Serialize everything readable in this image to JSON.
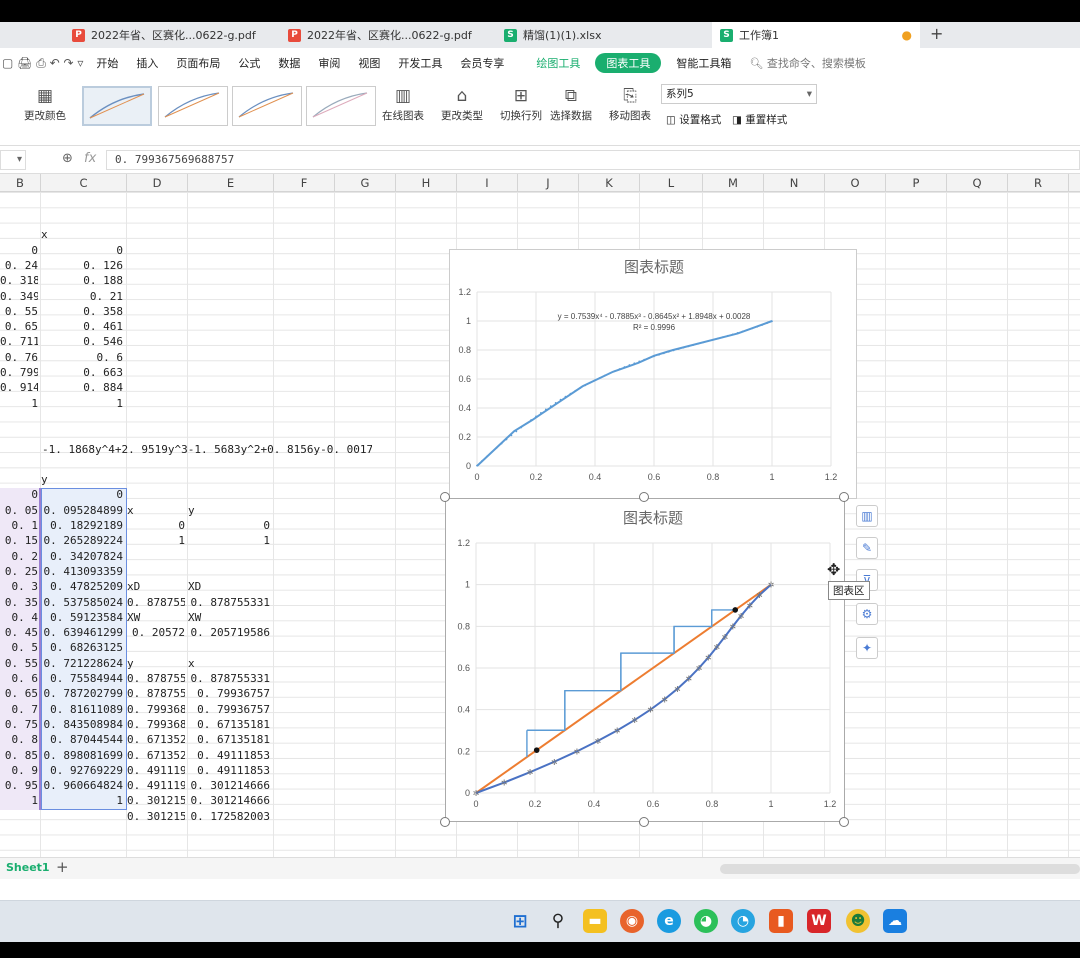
{
  "tabs": [
    {
      "label": "2022年省、区赛化...0622-g.pdf",
      "type": "pdf"
    },
    {
      "label": "2022年省、区赛化...0622-g.pdf",
      "type": "pdf"
    },
    {
      "label": "精馏(1)(1).xlsx",
      "type": "et"
    },
    {
      "label": "工作簿1",
      "type": "et"
    }
  ],
  "menu": {
    "items": [
      "开始",
      "插入",
      "页面布局",
      "公式",
      "数据",
      "审阅",
      "视图",
      "开发工具",
      "会员专享"
    ],
    "drawing_tools": "绘图工具",
    "chart_tools": "图表工具",
    "smart_tools": "智能工具箱",
    "search": "查找命令、搜索模板"
  },
  "ribbon": {
    "change_color": "更改颜色",
    "online_chart": "在线图表",
    "change_type": "更改类型",
    "switch_rowcol": "切换行列",
    "select_data": "选择数据",
    "move_chart": "移动图表",
    "series_select": "系列5",
    "set_format": "设置格式",
    "reset_style": "重置样式"
  },
  "formula_bar": {
    "fx": "fx",
    "value": "0. 799367569688757"
  },
  "columns": [
    "B",
    "C",
    "D",
    "E",
    "F",
    "G",
    "H",
    "I",
    "J",
    "K",
    "L",
    "M",
    "N",
    "O",
    "P",
    "Q",
    "R"
  ],
  "sheet": {
    "top_header": "x",
    "table1_b": [
      "0",
      "0. 24",
      "0. 318",
      "0. 349",
      "0. 55",
      "0. 65",
      "0. 711",
      "0. 76",
      "0. 799",
      "0. 914",
      "1"
    ],
    "table1_c": [
      "0",
      "0. 126",
      "0. 188",
      "0. 21",
      "0. 358",
      "0. 461",
      "0. 546",
      "0. 6",
      "0. 663",
      "0. 884",
      "1"
    ],
    "formula_text": "-1. 1868y^4+2. 9519y^3-1. 5683y^2+0. 8156y-0. 0017",
    "y_header": "y",
    "table2_b": [
      "0",
      "0. 05",
      "0. 1",
      "0. 15",
      "0. 2",
      "0. 25",
      "0. 3",
      "0. 35",
      "0. 4",
      "0. 45",
      "0. 5",
      "0. 55",
      "0. 6",
      "0. 65",
      "0. 7",
      "0. 75",
      "0. 8",
      "0. 85",
      "0. 9",
      "0. 95",
      "1"
    ],
    "table2_c": [
      "0",
      "0. 095284899",
      "0. 18292189",
      "0. 265289224",
      "0. 34207824",
      "0. 413093359",
      "0. 47825209",
      "0. 537585024",
      "0. 59123584",
      "0. 639461299",
      "0. 68263125",
      "0. 721228624",
      "0. 75584944",
      "0. 787202799",
      "0. 81611089",
      "0. 843508984",
      "0. 87044544",
      "0. 898081699",
      "0. 92769229",
      "0. 960664824",
      "1"
    ],
    "block_d_label_x": "x",
    "block_e_label_y": "y",
    "xy_d": [
      "0",
      "1"
    ],
    "xy_e": [
      "0",
      "1"
    ],
    "xd_d_label": "xD",
    "xd_e_label": "XD",
    "xd_d_value": "0. 878755",
    "xd_e_value": "0. 878755331",
    "xw_d_label": "XW",
    "xw_e_label": "XW",
    "xw_d_value": "0. 20572",
    "xw_e_value": "0. 205719586",
    "steps_header_d": "y",
    "steps_header_e": "x",
    "steps_d": [
      "0. 878755",
      "0. 878755",
      "0. 799368",
      "0. 799368",
      "0. 671352",
      "0. 671352",
      "0. 491119",
      "0. 491119",
      "0. 301215",
      "0. 301215"
    ],
    "steps_e": [
      "0. 878755331",
      "0. 79936757",
      "0. 79936757",
      "0. 67135181",
      "0. 67135181",
      "0. 49111853",
      "0. 49111853",
      "0. 301214666",
      "0. 301214666",
      "0. 172582003"
    ]
  },
  "tooltip": "图表区",
  "sheet_tab": "Sheet1",
  "colors": {
    "accent": "#1aae6f",
    "series_blue": "#5b9bd5",
    "series_orange": "#ed7d31",
    "step_blue": "#5b9bd5"
  },
  "chart_data": [
    {
      "type": "scatter",
      "title": "图表标题",
      "trendline_equation": "y = 0.7539x⁴ - 0.7885x³ - 0.8645x² + 1.8948x + 0.0028",
      "r_squared": "R² = 0.9996",
      "xlim": [
        0,
        1.2
      ],
      "ylim": [
        0,
        1.2
      ],
      "xticks": [
        "0",
        "0.2",
        "0.4",
        "0.6",
        "0.8",
        "1",
        "1.2"
      ],
      "yticks": [
        "0",
        "0.2",
        "0.4",
        "0.6",
        "0.8",
        "1",
        "1.2"
      ],
      "series": [
        {
          "x": [
            0,
            0.126,
            0.188,
            0.21,
            0.358,
            0.461,
            0.546,
            0.6,
            0.663,
            0.884,
            1
          ],
          "y": [
            0,
            0.24,
            0.318,
            0.349,
            0.55,
            0.65,
            0.711,
            0.76,
            0.799,
            0.914,
            1
          ]
        }
      ]
    },
    {
      "type": "scatter",
      "title": "图表标题",
      "xlim": [
        0,
        1.2
      ],
      "ylim": [
        0,
        1.2
      ],
      "xticks": [
        "0",
        "0.2",
        "0.4",
        "0.6",
        "0.8",
        "1",
        "1.2"
      ],
      "yticks": [
        "0",
        "0.2",
        "0.4",
        "0.6",
        "0.8",
        "1",
        "1.2"
      ],
      "equilibrium": {
        "x": [
          0,
          0.05,
          0.1,
          0.15,
          0.2,
          0.25,
          0.3,
          0.35,
          0.4,
          0.45,
          0.5,
          0.55,
          0.6,
          0.65,
          0.7,
          0.75,
          0.8,
          0.85,
          0.9,
          0.95,
          1
        ],
        "y": [
          0,
          0.095284899,
          0.18292189,
          0.265289224,
          0.34207824,
          0.413093359,
          0.47825209,
          0.537585024,
          0.59123584,
          0.639461299,
          0.68263125,
          0.721228624,
          0.75584944,
          0.787202799,
          0.81611089,
          0.843508984,
          0.87044544,
          0.898081699,
          0.92769229,
          0.960664824,
          1
        ]
      },
      "diagonal": {
        "x": [
          0,
          1
        ],
        "y": [
          0,
          1
        ]
      },
      "key_points": {
        "x": [
          0.878755,
          0.20572
        ],
        "y": [
          0.878755,
          0.20572
        ]
      },
      "steps": {
        "x": [
          0.878755331,
          0.79936757,
          0.79936757,
          0.67135181,
          0.67135181,
          0.49111853,
          0.49111853,
          0.301214666,
          0.301214666,
          0.172582003
        ],
        "y": [
          0.878755,
          0.878755,
          0.799368,
          0.799368,
          0.671352,
          0.671352,
          0.491119,
          0.491119,
          0.301215,
          0.301215
        ]
      }
    }
  ]
}
